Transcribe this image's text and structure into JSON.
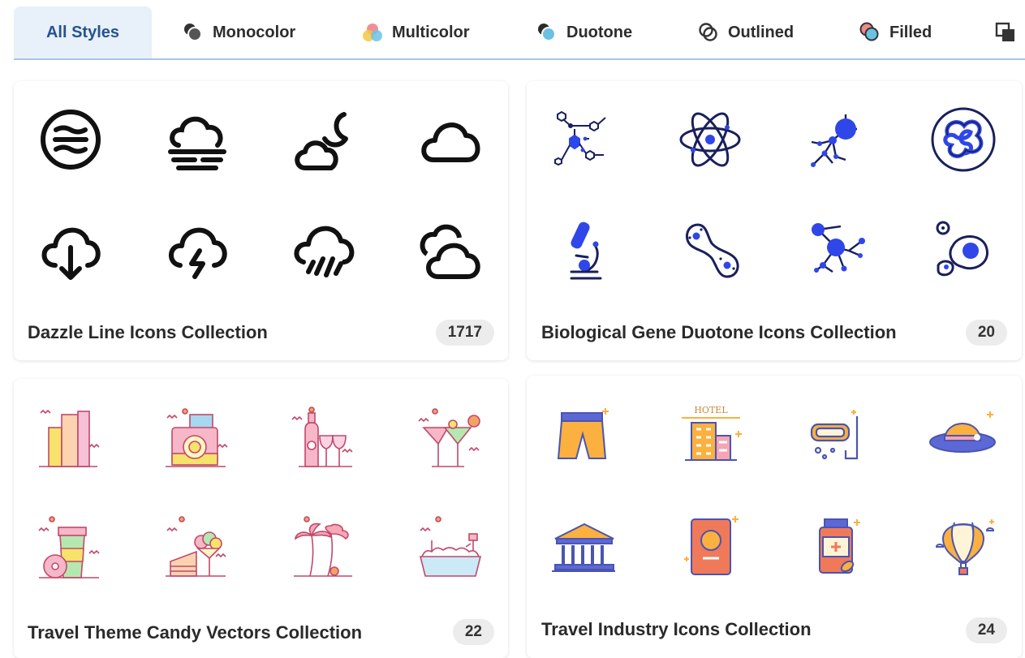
{
  "style_tabs": [
    {
      "label": "All Styles",
      "active": true
    },
    {
      "label": "Monocolor",
      "icon": "monocolor-icon"
    },
    {
      "label": "Multicolor",
      "icon": "multicolor-icon"
    },
    {
      "label": "Duotone",
      "icon": "duotone-icon"
    },
    {
      "label": "Outlined",
      "icon": "outlined-icon"
    },
    {
      "label": "Filled",
      "icon": "filled-icon"
    },
    {
      "label": "",
      "icon": "layered-squares-icon"
    }
  ],
  "collections": [
    {
      "title": "Dazzle Line Icons Collection",
      "count": "1717",
      "icons": [
        "wind-circle-icon",
        "fog-cloud-icon",
        "moon-cloud-icon",
        "cloud-icon",
        "cloud-download-icon",
        "thunder-cloud-icon",
        "rain-cloud-icon",
        "double-cloud-icon"
      ]
    },
    {
      "title": "Biological Gene Duotone Icons Collection",
      "count": "20",
      "icons": [
        "molecule-structure-icon",
        "atom-icon",
        "molecule-nodes-icon",
        "dna-circle-icon",
        "microscope-icon",
        "cell-division-icon",
        "molecule-network-icon",
        "cells-icon"
      ]
    },
    {
      "title": "Travel Theme Candy Vectors Collection",
      "count": "22",
      "icons": [
        "buildings-icon",
        "camera-icon",
        "wine-glasses-icon",
        "cocktails-icon",
        "coffee-donut-icon",
        "cake-icecream-icon",
        "palm-trees-icon",
        "bathtub-icon"
      ]
    },
    {
      "title": "Travel Industry Icons Collection",
      "count": "24",
      "icons": [
        "swim-shorts-icon",
        "hotel-icon",
        "snorkel-mask-icon",
        "sun-hat-icon",
        "museum-icon",
        "passport-icon",
        "medicine-bottle-icon",
        "hot-air-balloon-icon"
      ],
      "hotel_sign": "HOTEL"
    }
  ],
  "colors": {
    "tab_active_bg": "#e8f0f9",
    "tab_active_text": "#26538f",
    "divider": "#a9c6e8",
    "duotone_navy": "#1a1f5c",
    "duotone_blue": "#2f47e8",
    "badge_bg": "#ececec"
  }
}
